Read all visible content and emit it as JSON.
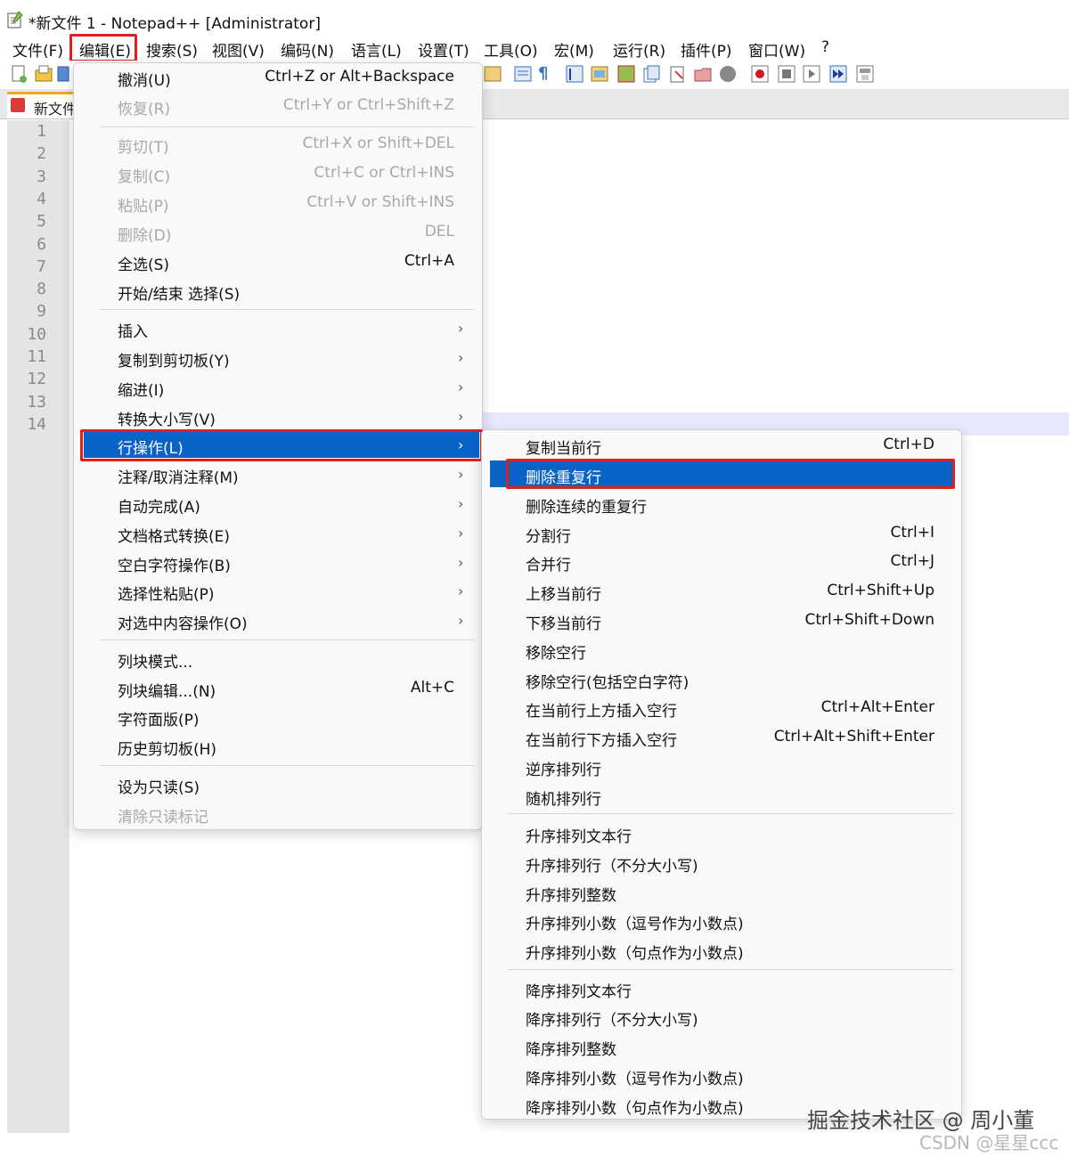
{
  "window": {
    "title": "*新文件 1 - Notepad++ [Administrator]"
  },
  "menubar": [
    {
      "label": "文件(F)"
    },
    {
      "label": "编辑(E)"
    },
    {
      "label": "搜索(S)"
    },
    {
      "label": "视图(V)"
    },
    {
      "label": "编码(N)"
    },
    {
      "label": "语言(L)"
    },
    {
      "label": "设置(T)"
    },
    {
      "label": "工具(O)"
    },
    {
      "label": "宏(M)"
    },
    {
      "label": "运行(R)"
    },
    {
      "label": "插件(P)"
    },
    {
      "label": "窗口(W)"
    },
    {
      "label": "?"
    }
  ],
  "tab": {
    "label": "新文件"
  },
  "line_numbers": [
    "1",
    "2",
    "3",
    "4",
    "5",
    "6",
    "7",
    "8",
    "9",
    "10",
    "11",
    "12",
    "13",
    "14"
  ],
  "edit_menu": [
    {
      "label": "撤消(U)",
      "shortcut": "Ctrl+Z or Alt+Backspace",
      "disabled": false
    },
    {
      "label": "恢复(R)",
      "shortcut": "Ctrl+Y or Ctrl+Shift+Z",
      "disabled": true
    },
    {
      "label": "剪切(T)",
      "shortcut": "Ctrl+X or Shift+DEL",
      "disabled": true
    },
    {
      "label": "复制(C)",
      "shortcut": "Ctrl+C or Ctrl+INS",
      "disabled": true
    },
    {
      "label": "粘贴(P)",
      "shortcut": "Ctrl+V or Shift+INS",
      "disabled": true
    },
    {
      "label": "删除(D)",
      "shortcut": "DEL",
      "disabled": true
    },
    {
      "label": "全选(S)",
      "shortcut": "Ctrl+A",
      "disabled": false
    },
    {
      "label": "开始/结束 选择(S)",
      "shortcut": "",
      "disabled": false
    },
    {
      "label": "插入",
      "shortcut": "",
      "disabled": false,
      "submenu": true
    },
    {
      "label": "复制到剪切板(Y)",
      "shortcut": "",
      "disabled": false,
      "submenu": true
    },
    {
      "label": "缩进(I)",
      "shortcut": "",
      "disabled": false,
      "submenu": true
    },
    {
      "label": "转换大小写(V)",
      "shortcut": "",
      "disabled": false,
      "submenu": true
    },
    {
      "label": "行操作(L)",
      "shortcut": "",
      "disabled": false,
      "submenu": true,
      "highlighted": true
    },
    {
      "label": "注释/取消注释(M)",
      "shortcut": "",
      "disabled": false,
      "submenu": true
    },
    {
      "label": "自动完成(A)",
      "shortcut": "",
      "disabled": false,
      "submenu": true
    },
    {
      "label": "文档格式转换(E)",
      "shortcut": "",
      "disabled": false,
      "submenu": true
    },
    {
      "label": "空白字符操作(B)",
      "shortcut": "",
      "disabled": false,
      "submenu": true
    },
    {
      "label": "选择性粘贴(P)",
      "shortcut": "",
      "disabled": false,
      "submenu": true
    },
    {
      "label": "对选中内容操作(O)",
      "shortcut": "",
      "disabled": false,
      "submenu": true
    },
    {
      "label": "列块模式...",
      "shortcut": "",
      "disabled": false
    },
    {
      "label": "列块编辑...(N)",
      "shortcut": "Alt+C",
      "disabled": false
    },
    {
      "label": "字符面版(P)",
      "shortcut": "",
      "disabled": false
    },
    {
      "label": "历史剪切板(H)",
      "shortcut": "",
      "disabled": false
    },
    {
      "label": "设为只读(S)",
      "shortcut": "",
      "disabled": false
    },
    {
      "label": "清除只读标记",
      "shortcut": "",
      "disabled": true
    }
  ],
  "line_ops_menu": [
    {
      "label": "复制当前行",
      "shortcut": "Ctrl+D"
    },
    {
      "label": "删除重复行",
      "shortcut": "",
      "highlighted": true
    },
    {
      "label": "删除连续的重复行",
      "shortcut": ""
    },
    {
      "label": "分割行",
      "shortcut": "Ctrl+I"
    },
    {
      "label": "合并行",
      "shortcut": "Ctrl+J"
    },
    {
      "label": "上移当前行",
      "shortcut": "Ctrl+Shift+Up"
    },
    {
      "label": "下移当前行",
      "shortcut": "Ctrl+Shift+Down"
    },
    {
      "label": "移除空行",
      "shortcut": ""
    },
    {
      "label": "移除空行(包括空白字符)",
      "shortcut": ""
    },
    {
      "label": "在当前行上方插入空行",
      "shortcut": "Ctrl+Alt+Enter"
    },
    {
      "label": "在当前行下方插入空行",
      "shortcut": "Ctrl+Alt+Shift+Enter"
    },
    {
      "label": "逆序排列行",
      "shortcut": ""
    },
    {
      "label": "随机排列行",
      "shortcut": ""
    },
    {
      "label": "升序排列文本行",
      "shortcut": ""
    },
    {
      "label": "升序排列行（不分大小写)",
      "shortcut": ""
    },
    {
      "label": "升序排列整数",
      "shortcut": ""
    },
    {
      "label": "升序排列小数（逗号作为小数点)",
      "shortcut": ""
    },
    {
      "label": "升序排列小数（句点作为小数点)",
      "shortcut": ""
    },
    {
      "label": "降序排列文本行",
      "shortcut": ""
    },
    {
      "label": "降序排列行（不分大小写)",
      "shortcut": ""
    },
    {
      "label": "降序排列整数",
      "shortcut": ""
    },
    {
      "label": "降序排列小数（逗号作为小数点)",
      "shortcut": ""
    },
    {
      "label": "降序排列小数（句点作为小数点)",
      "shortcut": ""
    }
  ],
  "watermarks": {
    "primary": "掘金技术社区 @ 周小董",
    "secondary": "CSDN @星星ccc"
  },
  "colors": {
    "highlight": "#0a64c8",
    "annotation": "#e02020",
    "tab_accent": "#f5a623"
  }
}
